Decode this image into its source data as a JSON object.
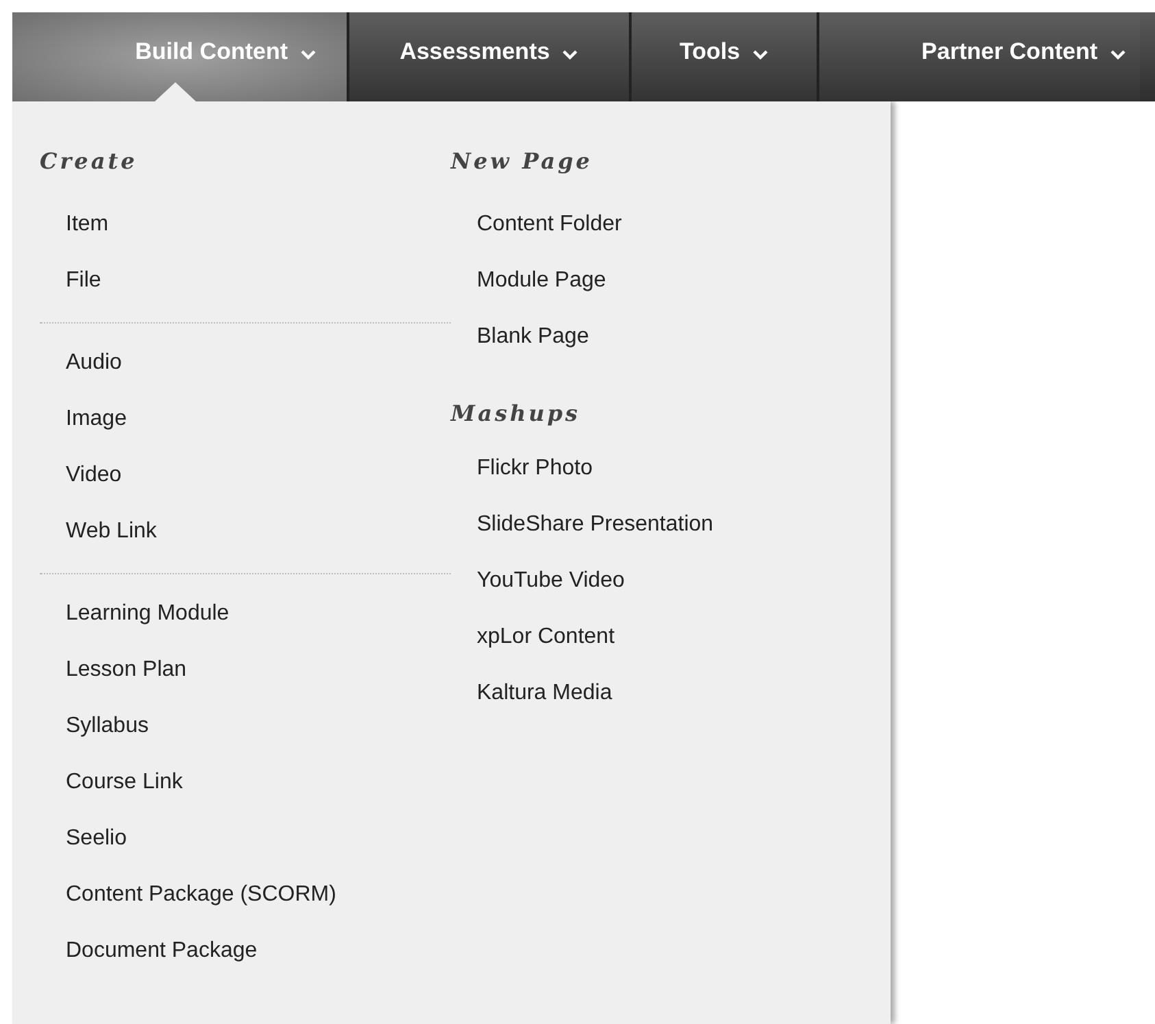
{
  "tabs": [
    {
      "label": "Build Content",
      "selected": true
    },
    {
      "label": "Assessments",
      "selected": false
    },
    {
      "label": "Tools",
      "selected": false
    },
    {
      "label": "Partner Content",
      "selected": false
    }
  ],
  "menu": {
    "columns": [
      {
        "sections": [
          {
            "heading": "Create",
            "groups": [
              [
                "Item",
                "File"
              ],
              [
                "Audio",
                "Image",
                "Video",
                "Web Link"
              ],
              [
                "Learning Module",
                "Lesson Plan",
                "Syllabus",
                "Course Link",
                "Seelio",
                "Content Package (SCORM)",
                "Document Package"
              ]
            ]
          }
        ]
      },
      {
        "sections": [
          {
            "heading": "New Page",
            "groups": [
              [
                "Content Folder",
                "Module Page",
                "Blank Page"
              ]
            ]
          },
          {
            "heading": "Mashups",
            "groups": [
              [
                "Flickr Photo",
                "SlideShare Presentation",
                "YouTube Video",
                "xpLor Content",
                "Kaltura Media"
              ]
            ]
          }
        ]
      }
    ]
  }
}
